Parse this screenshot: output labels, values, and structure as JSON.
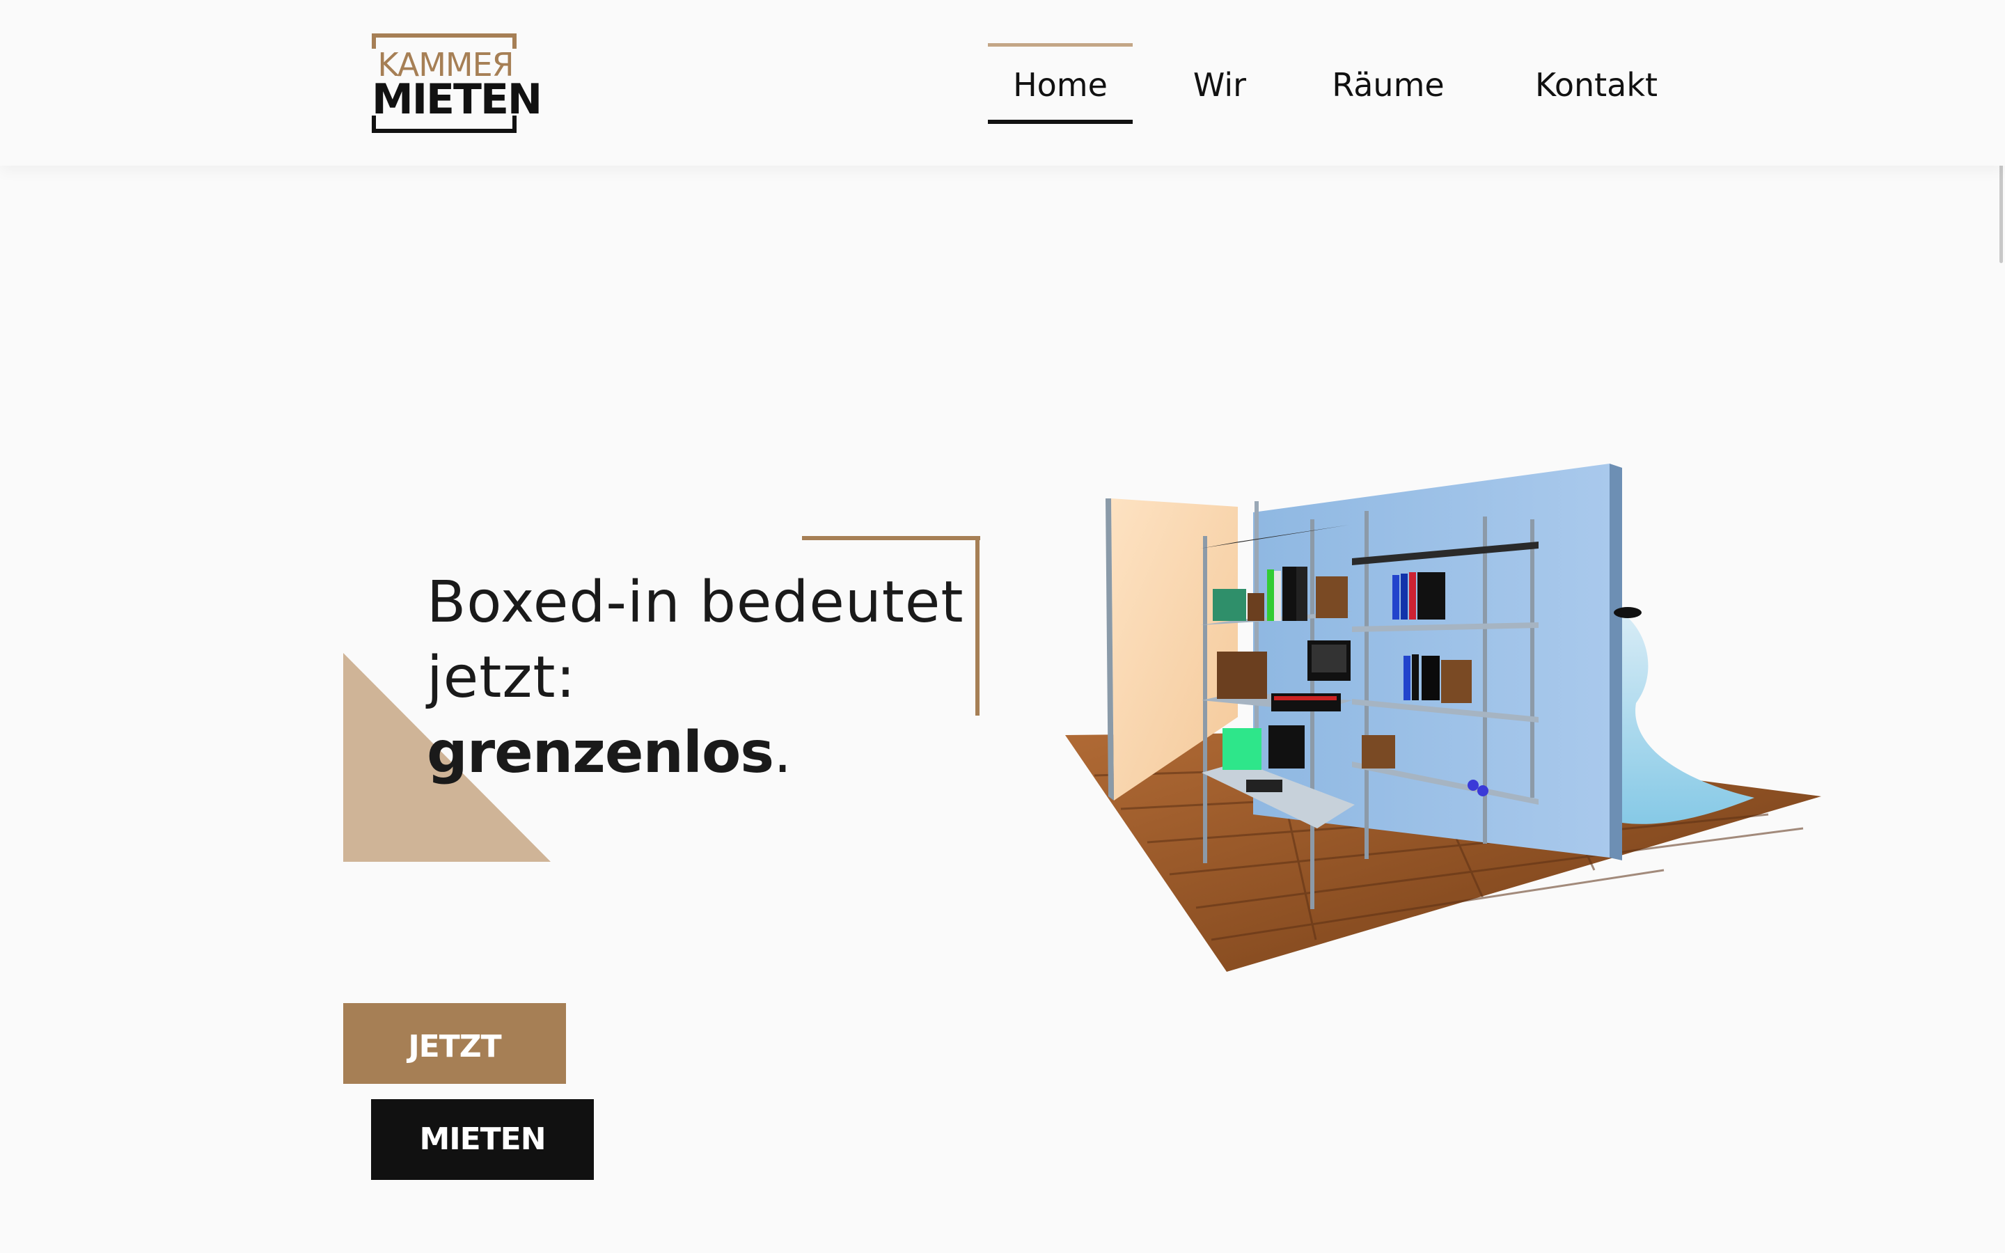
{
  "brand": {
    "logo_top": "KAMMEЯ",
    "logo_bottom": "MIETEN",
    "accent_color": "#a67f55",
    "dark_color": "#111111"
  },
  "nav": {
    "items": [
      {
        "label": "Home",
        "active": true
      },
      {
        "label": "Wir",
        "active": false
      },
      {
        "label": "Räume",
        "active": false
      },
      {
        "label": "Kontakt",
        "active": false
      }
    ]
  },
  "hero": {
    "line1": "Boxed-in bedeutet",
    "line2": "jetzt:",
    "line3_bold": "grenzenlos",
    "line3_suffix": ".",
    "cta_primary": "JETZT",
    "cta_secondary": "MIETEN",
    "illustration": "3d-storage-room-with-shelves"
  }
}
